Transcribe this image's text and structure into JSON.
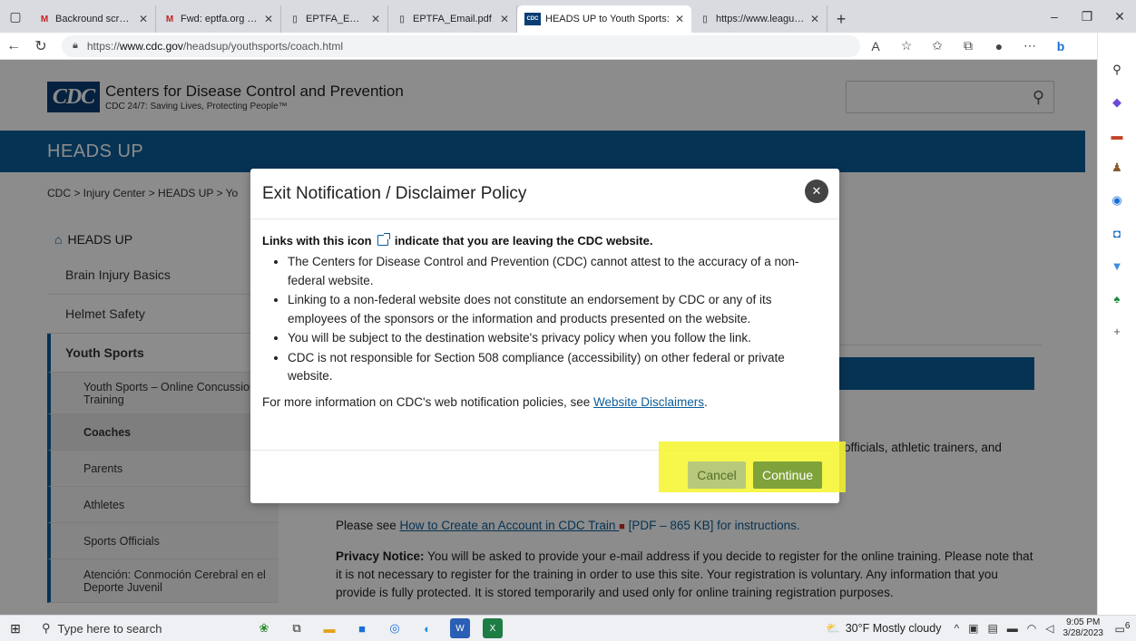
{
  "browser": {
    "tabs": [
      {
        "icon": "gmail-icon",
        "title": "Backround screening - susa"
      },
      {
        "icon": "gmail-icon",
        "title": "Fwd: eptfa.org - Member De"
      },
      {
        "icon": "pdf-icon",
        "title": "EPTFA_Email.pdf"
      },
      {
        "icon": "pdf-icon",
        "title": "EPTFA_Email.pdf"
      },
      {
        "icon": "cdc-icon",
        "title": "HEADS UP to Youth Sports:",
        "active": true
      },
      {
        "icon": "page-icon",
        "title": "https://www.leagueathletic"
      }
    ],
    "url_prefix": "https://",
    "url_domain": "www.cdc.gov",
    "url_path": "/headsup/youthsports/coach.html"
  },
  "site": {
    "logo": "CDC",
    "name": "Centers for Disease Control and Prevention",
    "tagline": "CDC 24/7: Saving Lives, Protecting People™",
    "banner": "HEADS UP",
    "breadcrumb": "CDC  >  Injury Center  >  HEADS UP  >  Yo"
  },
  "leftnav": {
    "home": "HEADS UP",
    "items": [
      "Brain Injury Basics",
      "Helmet Safety"
    ],
    "section": "Youth Sports",
    "subitems": [
      {
        "label": "Youth Sports – Online Concussion Training"
      },
      {
        "label": "Coaches",
        "current": true
      },
      {
        "label": "Parents"
      },
      {
        "label": "Athletes"
      },
      {
        "label": "Sports Officials"
      },
      {
        "label": "Atención: Conmoción Cerebral en el Deporte Juvenil"
      }
    ]
  },
  "main": {
    "line_officials": "officials, athletic trainers, and",
    "see_prefix": "Please see ",
    "see_link": "How to Create an Account in CDC Train ",
    "see_suffix": " [PDF – 865 KB] for instructions.",
    "privacy_label": "Privacy Notice:",
    "privacy_text": " You will be asked to provide your e-mail address if you decide to register for the online training. Please note that it is not necessary to register for the training in order to use this site. Your registration is voluntary. Any information that you provide is fully protected. It is stored temporarily and used only for online training registration purposes."
  },
  "modal": {
    "title": "Exit Notification / Disclaimer Policy",
    "lead_before": "Links with this icon ",
    "lead_after": " indicate that you are leaving the CDC website.",
    "bullets": [
      "The Centers for Disease Control and Prevention (CDC) cannot attest to the accuracy of a non-federal website.",
      "Linking to a non-federal website does not constitute an endorsement by CDC or any of its employees of the sponsors or the information and products presented on the website.",
      "You will be subject to the destination website's privacy policy when you follow the link.",
      "CDC is not responsible for Section 508 compliance (accessibility) on other federal or private website."
    ],
    "more_text": "For more information on CDC's web notification policies, see ",
    "more_link": "Website Disclaimers",
    "more_end": ".",
    "cancel_label": "Cancel",
    "continue_label": "Continue",
    "highlight_color": "#f5f52c"
  },
  "taskbar": {
    "search_placeholder": "Type here to search",
    "weather": "30°F  Mostly cloudy",
    "time": "9:05 PM",
    "date": "3/28/2023",
    "notifications": "6"
  },
  "colors": {
    "cdc_blue": "#0b5d99",
    "continue_green": "#7fa23a"
  }
}
